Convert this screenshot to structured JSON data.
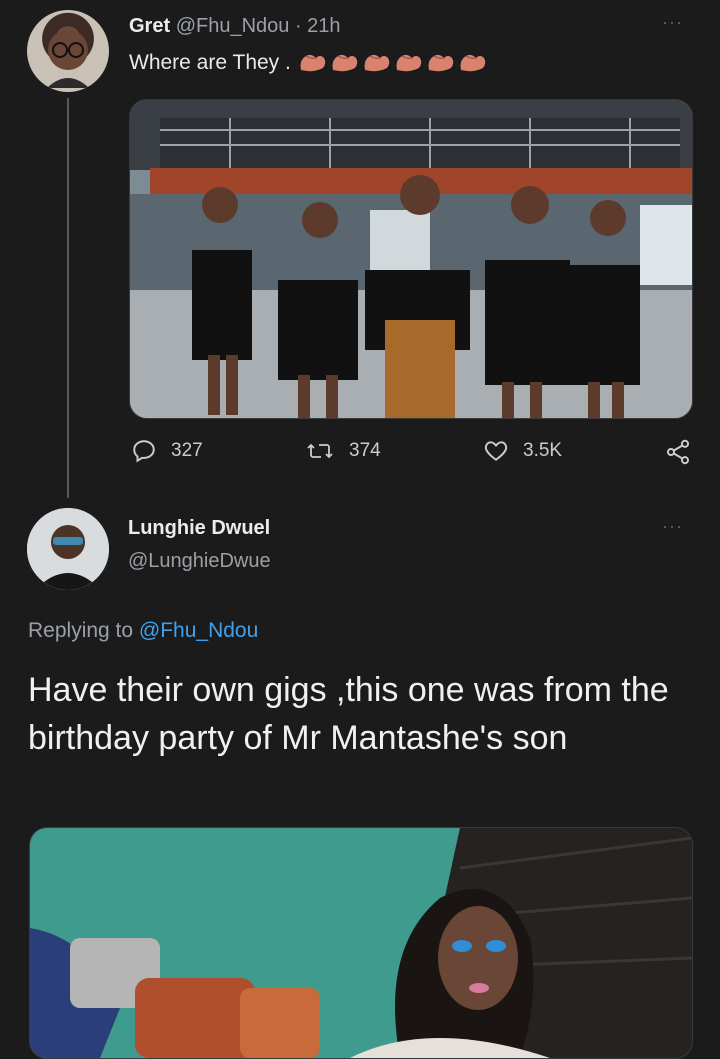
{
  "tweet": {
    "name": "Gret",
    "handle": "@Fhu_Ndou",
    "time": "· 21h",
    "text": "Where are They .",
    "emoji_count": 6,
    "stats": {
      "replies": "327",
      "retweets": "374",
      "likes": "3.5K"
    }
  },
  "reply": {
    "name": "Lunghie Dwuel",
    "handle": "@LunghieDwue",
    "replying_prefix": "Replying to ",
    "replying_to": "@Fhu_Ndou",
    "text": "Have their own gigs ,this one was from the birthday party of Mr Mantashe's son"
  },
  "ui": {
    "more": "···"
  }
}
